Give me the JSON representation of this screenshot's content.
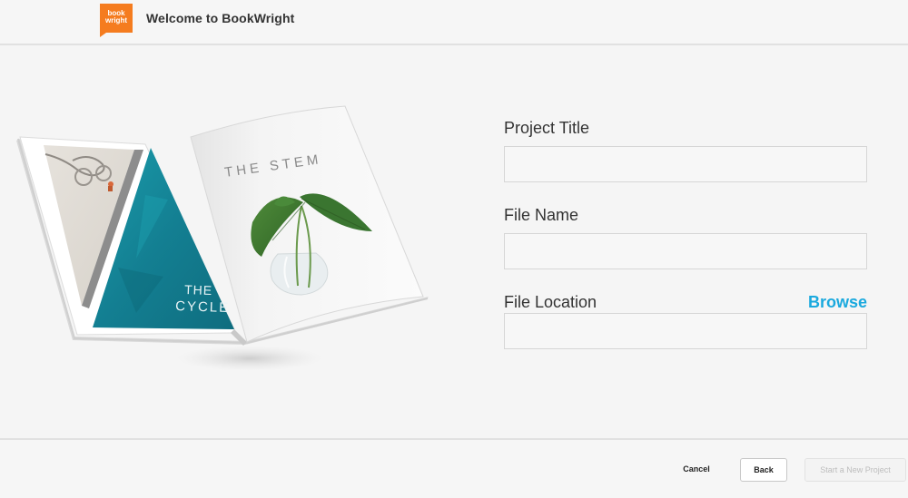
{
  "header": {
    "logo_line1": "book",
    "logo_line2": "wright",
    "title": "Welcome to BookWright"
  },
  "illustration": {
    "left_page_text": "THE CYCLE",
    "right_page_text": "THE STEM"
  },
  "form": {
    "project_title": {
      "label": "Project Title",
      "value": "",
      "placeholder": ""
    },
    "file_name": {
      "label": "File Name",
      "value": "",
      "placeholder": ""
    },
    "file_location": {
      "label": "File Location",
      "value": "",
      "placeholder": "",
      "browse_label": "Browse"
    }
  },
  "footer": {
    "cancel_label": "Cancel",
    "back_label": "Back",
    "start_label": "Start a New Project"
  },
  "colors": {
    "brand_orange": "#f57c1f",
    "link_blue": "#1aa9de",
    "background": "#f5f5f5"
  }
}
